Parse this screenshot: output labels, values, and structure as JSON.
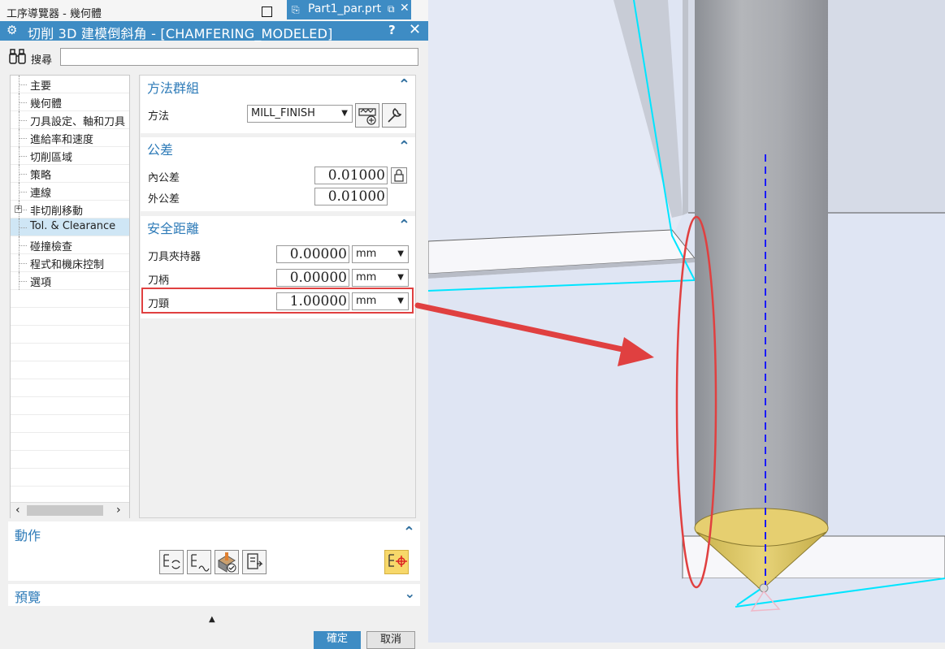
{
  "navigator": {
    "title": "工序導覽器 - 幾何體"
  },
  "file_tab": {
    "label": "Part1_par.prt"
  },
  "dialog": {
    "title": "切削 3D 建模倒斜角 - [CHAMFERING_MODELED]",
    "help": "?",
    "close": "✕"
  },
  "search": {
    "label": "搜尋",
    "value": ""
  },
  "tree": {
    "items": [
      {
        "label": "主要"
      },
      {
        "label": "幾何體"
      },
      {
        "label": "刀具設定、軸和刀具"
      },
      {
        "label": "進給率和速度"
      },
      {
        "label": "切削區域"
      },
      {
        "label": "策略"
      },
      {
        "label": "連線"
      },
      {
        "label": "非切削移動"
      },
      {
        "label": "Tol. & Clearance"
      },
      {
        "label": "碰撞檢查"
      },
      {
        "label": "程式和機床控制"
      },
      {
        "label": "選項"
      }
    ],
    "selected_index": 8,
    "expandable_index": 7
  },
  "method_group": {
    "title": "方法群組",
    "method_label": "方法",
    "method_value": "MILL_FINISH"
  },
  "tolerance": {
    "title": "公差",
    "inner_label": "內公差",
    "inner_value": "0.01000",
    "outer_label": "外公差",
    "outer_value": "0.01000"
  },
  "clearance": {
    "title": "安全距離",
    "rows": [
      {
        "label": "刀具夾持器",
        "value": "0.00000",
        "unit": "mm"
      },
      {
        "label": "刀柄",
        "value": "0.00000",
        "unit": "mm"
      },
      {
        "label": "刀頸",
        "value": "1.00000",
        "unit": "mm"
      }
    ]
  },
  "actions": {
    "title": "動作"
  },
  "preview": {
    "title": "預覽"
  },
  "buttons": {
    "ok": "確定",
    "cancel": "取消"
  },
  "colors": {
    "accent": "#3e8cc4",
    "highlight": "#e04040",
    "toolpath": "#00e5ff",
    "axis": "#1a1aff",
    "cone": "#e6cf70"
  }
}
